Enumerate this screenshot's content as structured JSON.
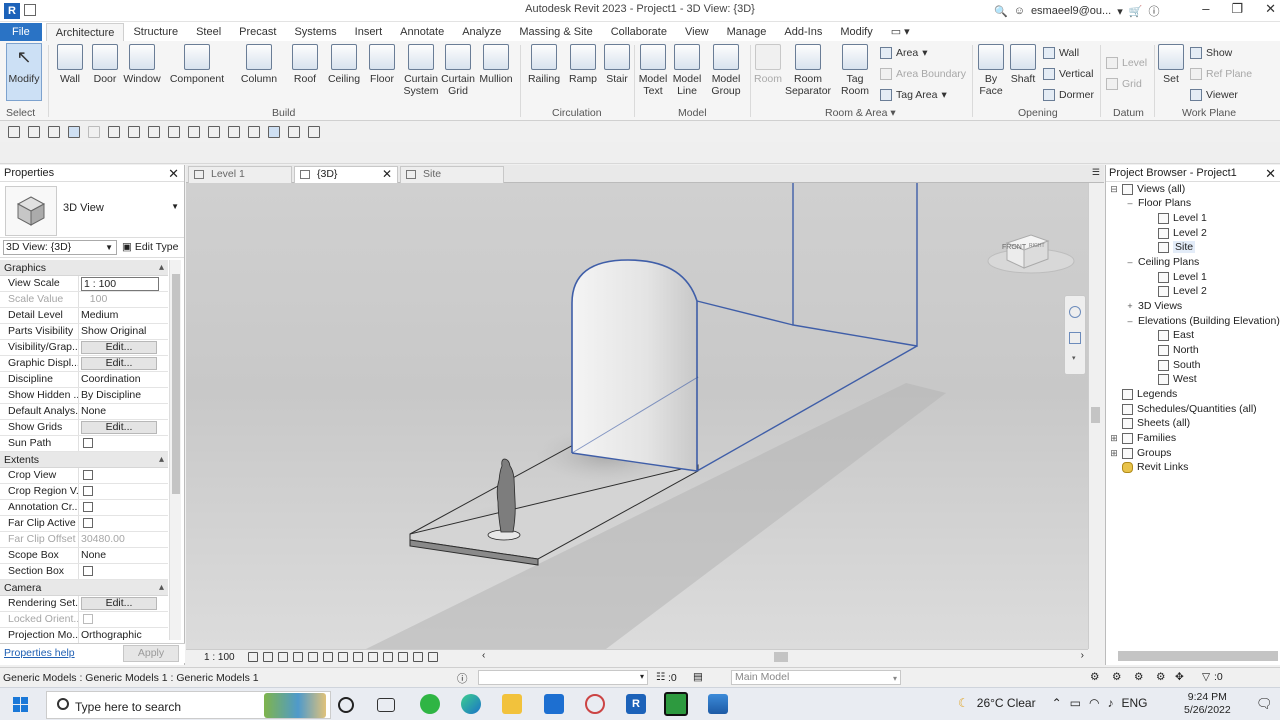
{
  "window": {
    "title": "Autodesk Revit 2023 - Project1 - 3D View: {3D}",
    "user": "esmaeel9@ou...",
    "app_icon": "R"
  },
  "ribbon_tabs": [
    "File",
    "Architecture",
    "Structure",
    "Steel",
    "Precast",
    "Systems",
    "Insert",
    "Annotate",
    "Analyze",
    "Massing & Site",
    "Collaborate",
    "View",
    "Manage",
    "Add-Ins",
    "Modify"
  ],
  "ribbon": {
    "modify": "Modify",
    "select": "Select",
    "build": {
      "wall": "Wall",
      "door": "Door",
      "window": "Window",
      "component": "Component",
      "column": "Column",
      "roof": "Roof",
      "ceiling": "Ceiling",
      "floor": "Floor",
      "curtain_system": "Curtain System",
      "curtain_grid": "Curtain Grid",
      "mullion": "Mullion",
      "label": "Build"
    },
    "circulation": {
      "railing": "Railing",
      "ramp": "Ramp",
      "stair": "Stair",
      "label": "Circulation"
    },
    "model": {
      "model_text": "Model Text",
      "model_line": "Model Line",
      "model_group": "Model Group",
      "label": "Model"
    },
    "room_area": {
      "room": "Room",
      "room_separator": "Room Separator",
      "tag_room": "Tag Room",
      "area": "Area",
      "area_boundary": "Area Boundary",
      "tag_area": "Tag Area",
      "label": "Room & Area"
    },
    "opening": {
      "by_face": "By Face",
      "shaft": "Shaft",
      "wall": "Wall",
      "vertical": "Vertical",
      "dormer": "Dormer",
      "label": "Opening"
    },
    "datum": {
      "level": "Level",
      "grid": "Grid",
      "label": "Datum"
    },
    "work_plane": {
      "set": "Set",
      "show": "Show",
      "ref_plane": "Ref Plane",
      "viewer": "Viewer",
      "label": "Work Plane"
    }
  },
  "properties": {
    "title": "Properties",
    "type_name": "3D View",
    "instance_selector": "3D View: {3D}",
    "edit_type": "Edit Type",
    "categories": {
      "graphics": "Graphics",
      "extents": "Extents",
      "camera": "Camera"
    },
    "graphics_rows": [
      {
        "k": "View Scale",
        "v": "1 : 100"
      },
      {
        "k": "Scale Value",
        "v": "100"
      },
      {
        "k": "Detail Level",
        "v": "Medium"
      },
      {
        "k": "Parts Visibility",
        "v": "Show Original"
      },
      {
        "k": "Visibility/Grap...",
        "v": "Edit..."
      },
      {
        "k": "Graphic Displ...",
        "v": "Edit..."
      },
      {
        "k": "Discipline",
        "v": "Coordination"
      },
      {
        "k": "Show Hidden ...",
        "v": "By Discipline"
      },
      {
        "k": "Default Analys...",
        "v": "None"
      },
      {
        "k": "Show Grids",
        "v": "Edit..."
      },
      {
        "k": "Sun Path",
        "v": ""
      }
    ],
    "extents_rows": [
      {
        "k": "Crop View",
        "v": ""
      },
      {
        "k": "Crop Region V...",
        "v": ""
      },
      {
        "k": "Annotation Cr...",
        "v": ""
      },
      {
        "k": "Far Clip Active",
        "v": ""
      },
      {
        "k": "Far Clip Offset",
        "v": "30480.00"
      },
      {
        "k": "Scope Box",
        "v": "None"
      },
      {
        "k": "Section Box",
        "v": ""
      }
    ],
    "camera_rows": [
      {
        "k": "Rendering Set...",
        "v": "Edit..."
      },
      {
        "k": "Locked Orient...",
        "v": ""
      },
      {
        "k": "Projection Mo...",
        "v": "Orthographic"
      }
    ],
    "scale_prefix": "1:",
    "help": "Properties help",
    "apply": "Apply"
  },
  "view_tabs": [
    {
      "label": "Level 1"
    },
    {
      "label": "{3D}"
    },
    {
      "label": "Site"
    }
  ],
  "viewcube": {
    "front": "FRONT",
    "right": "RIGHT"
  },
  "view_bar": {
    "scale": "1 : 100"
  },
  "project_browser": {
    "title": "Project Browser - Project1",
    "root": "Views (all)",
    "floor_plans": "Floor Plans",
    "fp_items": [
      "Level 1",
      "Level 2",
      "Site"
    ],
    "ceiling_plans": "Ceiling Plans",
    "cp_items": [
      "Level 1",
      "Level 2"
    ],
    "views_3d": "3D Views",
    "elevations": "Elevations (Building Elevation)",
    "el_items": [
      "East",
      "North",
      "South",
      "West"
    ],
    "legends": "Legends",
    "schedules": "Schedules/Quantities (all)",
    "sheets": "Sheets (all)",
    "families": "Families",
    "groups": "Groups",
    "revit_links": "Revit Links"
  },
  "status_bar": {
    "message": "Generic Models : Generic Models 1 : Generic Models 1",
    "zero": ":0",
    "main_model": "Main Model",
    "filter": ":0"
  },
  "taskbar": {
    "search_placeholder": "Type here to search",
    "weather": "26°C  Clear",
    "lang": "ENG",
    "time": "9:24 PM",
    "date": "5/26/2022"
  }
}
